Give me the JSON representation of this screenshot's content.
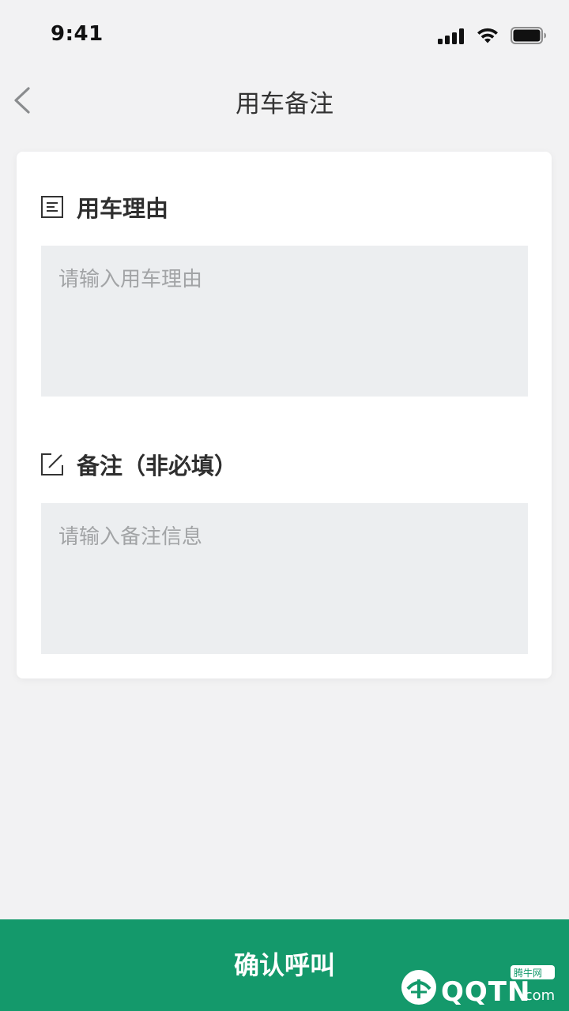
{
  "status_bar": {
    "time": "9:41",
    "icons": [
      "signal-icon",
      "wifi-icon",
      "battery-icon"
    ]
  },
  "nav": {
    "back_icon": "chevron-left-icon",
    "title": "用车备注"
  },
  "form": {
    "reason": {
      "icon": "list-document-icon",
      "label": "用车理由",
      "placeholder": "请输入用车理由",
      "value": ""
    },
    "remark": {
      "icon": "edit-icon",
      "label": "备注（非必填）",
      "placeholder": "请输入备注信息",
      "value": ""
    }
  },
  "actions": {
    "confirm_label": "确认呼叫"
  },
  "watermark": {
    "brand": "QQTN",
    "domain": ".com",
    "tag": "腾牛网"
  },
  "colors": {
    "background": "#f2f2f3",
    "card": "#ffffff",
    "field": "#eceef0",
    "accent": "#14996b",
    "placeholder": "#a2a4a6"
  }
}
